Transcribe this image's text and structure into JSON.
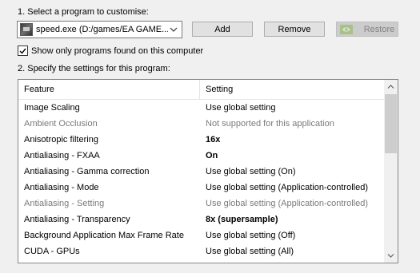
{
  "step1_label": "1. Select a program to customise:",
  "program_select": {
    "value": "speed.exe (D:/games/EA GAME..."
  },
  "buttons": {
    "add_label": "Add",
    "remove_label": "Remove",
    "restore_label": "Restore",
    "restore_enabled": false
  },
  "checkbox": {
    "label": "Show only programs found on this computer",
    "checked": true
  },
  "step2_label": "2. Specify the settings for this program:",
  "table": {
    "headers": {
      "feature": "Feature",
      "setting": "Setting"
    },
    "rows": [
      {
        "feature": "Image Scaling",
        "setting": "Use global setting",
        "disabled": false,
        "bold": false
      },
      {
        "feature": "Ambient Occlusion",
        "setting": "Not supported for this application",
        "disabled": true,
        "bold": false
      },
      {
        "feature": "Anisotropic filtering",
        "setting": "16x",
        "disabled": false,
        "bold": true
      },
      {
        "feature": "Antialiasing - FXAA",
        "setting": "On",
        "disabled": false,
        "bold": true
      },
      {
        "feature": "Antialiasing - Gamma correction",
        "setting": "Use global setting (On)",
        "disabled": false,
        "bold": false
      },
      {
        "feature": "Antialiasing - Mode",
        "setting": "Use global setting (Application-controlled)",
        "disabled": false,
        "bold": false
      },
      {
        "feature": "Antialiasing - Setting",
        "setting": "Use global setting (Application-controlled)",
        "disabled": true,
        "bold": false
      },
      {
        "feature": "Antialiasing - Transparency",
        "setting": "8x (supersample)",
        "disabled": false,
        "bold": true
      },
      {
        "feature": "Background Application Max Frame Rate",
        "setting": "Use global setting (Off)",
        "disabled": false,
        "bold": false
      },
      {
        "feature": "CUDA - GPUs",
        "setting": "Use global setting (All)",
        "disabled": false,
        "bold": false
      }
    ]
  },
  "colors": {
    "background": "#f0f0f0",
    "disabled_text": "#7a7a7a",
    "nvidia_green": "#76b900"
  },
  "icons": {
    "program": "game-exe-icon",
    "dropdown": "chevron-down-icon",
    "restore": "nvidia-logo-icon",
    "scroll_up": "chevron-up-icon",
    "scroll_down": "chevron-down-icon"
  }
}
